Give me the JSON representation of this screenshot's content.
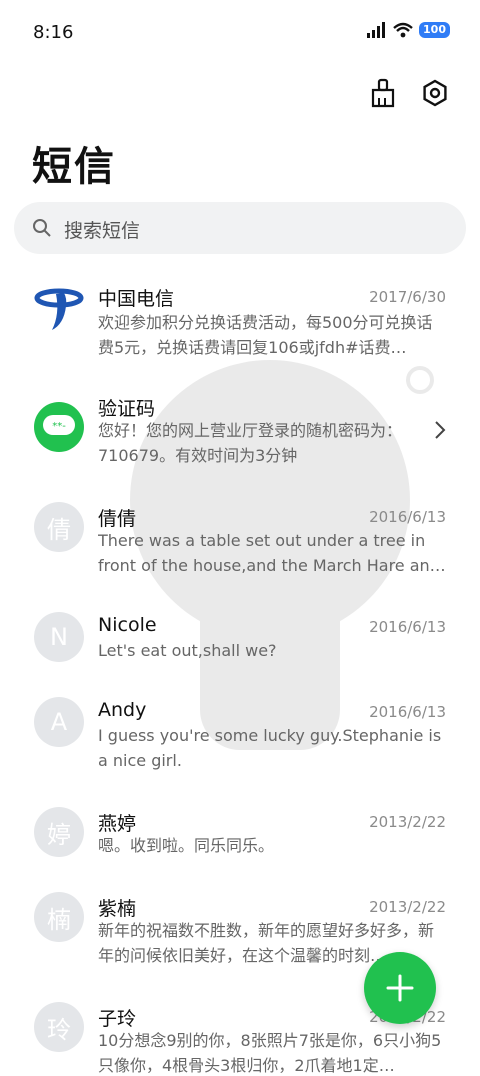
{
  "status": {
    "time": "8:16",
    "battery": "100"
  },
  "header": {
    "title": "短信"
  },
  "search": {
    "placeholder": "搜索短信"
  },
  "messages": [
    {
      "name": "中国电信",
      "date": "2017/6/30",
      "preview": "欢迎参加积分兑换话费活动，每500分可兑换话费5元，兑换话费请回复106或jfdh#话费…",
      "avatar": ""
    },
    {
      "name": "验证码",
      "date": "",
      "preview": "您好！您的网上营业厅登录的随机密码为：710679。有效时间为3分钟",
      "avatar": ""
    },
    {
      "name": "倩倩",
      "date": "2016/6/13",
      "preview": "There was a table set out under a tree in front of the house,and the March Hare an…",
      "avatar": "倩"
    },
    {
      "name": "Nicole",
      "date": "2016/6/13",
      "preview": "Let's eat out,shall we?",
      "avatar": "N"
    },
    {
      "name": "Andy",
      "date": "2016/6/13",
      "preview": "I guess you're some lucky guy.Stephanie is a nice girl.",
      "avatar": "A"
    },
    {
      "name": "燕婷",
      "date": "2013/2/22",
      "preview": "嗯。收到啦。同乐同乐。",
      "avatar": "婷"
    },
    {
      "name": "紫楠",
      "date": "2013/2/22",
      "preview": "新年的祝福数不胜数，新年的愿望好多好多，新年的问候依旧美好，在这个温馨的时刻…",
      "avatar": "楠"
    },
    {
      "name": "子玲",
      "date": "2013/2/22",
      "preview": "10分想念9别的你，8张照片7张是你，6只小狗5只像你，4根骨头3根归你，2爪着地1定…",
      "avatar": "玲"
    }
  ]
}
